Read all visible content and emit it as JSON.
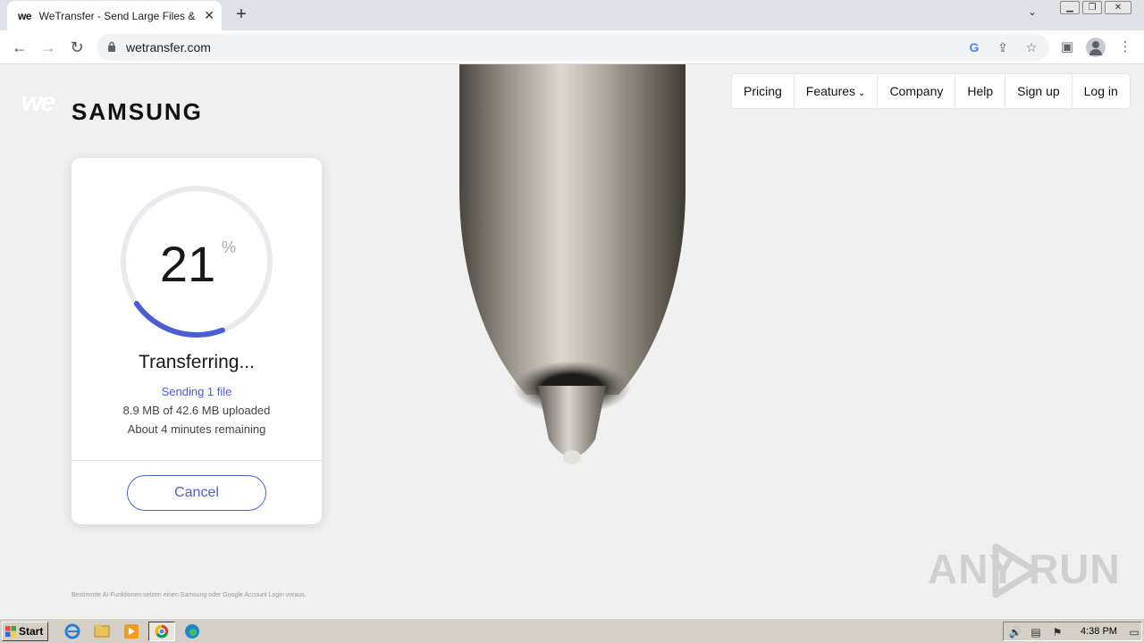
{
  "browser": {
    "tab_title": "WeTransfer - Send Large Files & Sha",
    "tab_favicon": "we",
    "url": "wetransfer.com"
  },
  "page": {
    "brand": "SAMSUNG",
    "we_logo": "we",
    "nav": {
      "pricing": "Pricing",
      "features": "Features",
      "company": "Company",
      "help": "Help",
      "signup": "Sign up",
      "login": "Log in"
    },
    "transfer": {
      "percent": "21",
      "percent_sign": "%",
      "progress_fraction": 0.21,
      "status": "Transferring...",
      "sending": "Sending 1 file",
      "uploaded": "8.9 MB of 42.6 MB uploaded",
      "remaining": "About 4 minutes remaining",
      "cancel_label": "Cancel"
    },
    "legal": "Bestimmte AI-Funktionen setzen einen Samsung oder Google Account Login voraus."
  },
  "watermark": "ANY RUN",
  "taskbar": {
    "start_label": "Start",
    "clock": "4:38 PM"
  },
  "colors": {
    "accent": "#4a5fd4",
    "ring_track": "#e8eaee"
  }
}
